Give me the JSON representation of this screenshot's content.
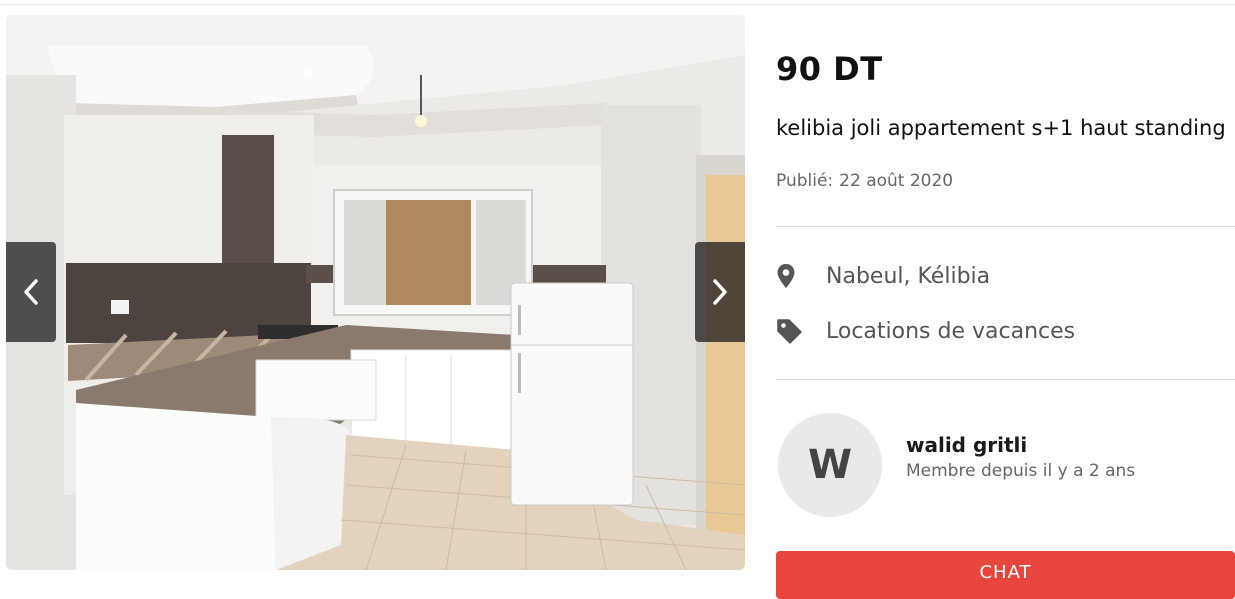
{
  "listing": {
    "price": "90 DT",
    "title": "kelibia joli appartement s+1 haut standing",
    "published_label": "Publié:",
    "published_date": "22 août 2020",
    "location": "Nabeul, Kélibia",
    "category": "Locations de vacances"
  },
  "seller": {
    "initial": "W",
    "name": "walid gritli",
    "member_since": "Membre depuis il y a 2 ans"
  },
  "actions": {
    "chat_label": "CHAT"
  },
  "gallery": {
    "prev_icon": "chevron-left-icon",
    "next_icon": "chevron-right-icon",
    "photo_description_hidden": ""
  },
  "colors": {
    "accent": "#e8453c",
    "icon": "#555555",
    "avatar_bg": "#e9e9e9"
  }
}
